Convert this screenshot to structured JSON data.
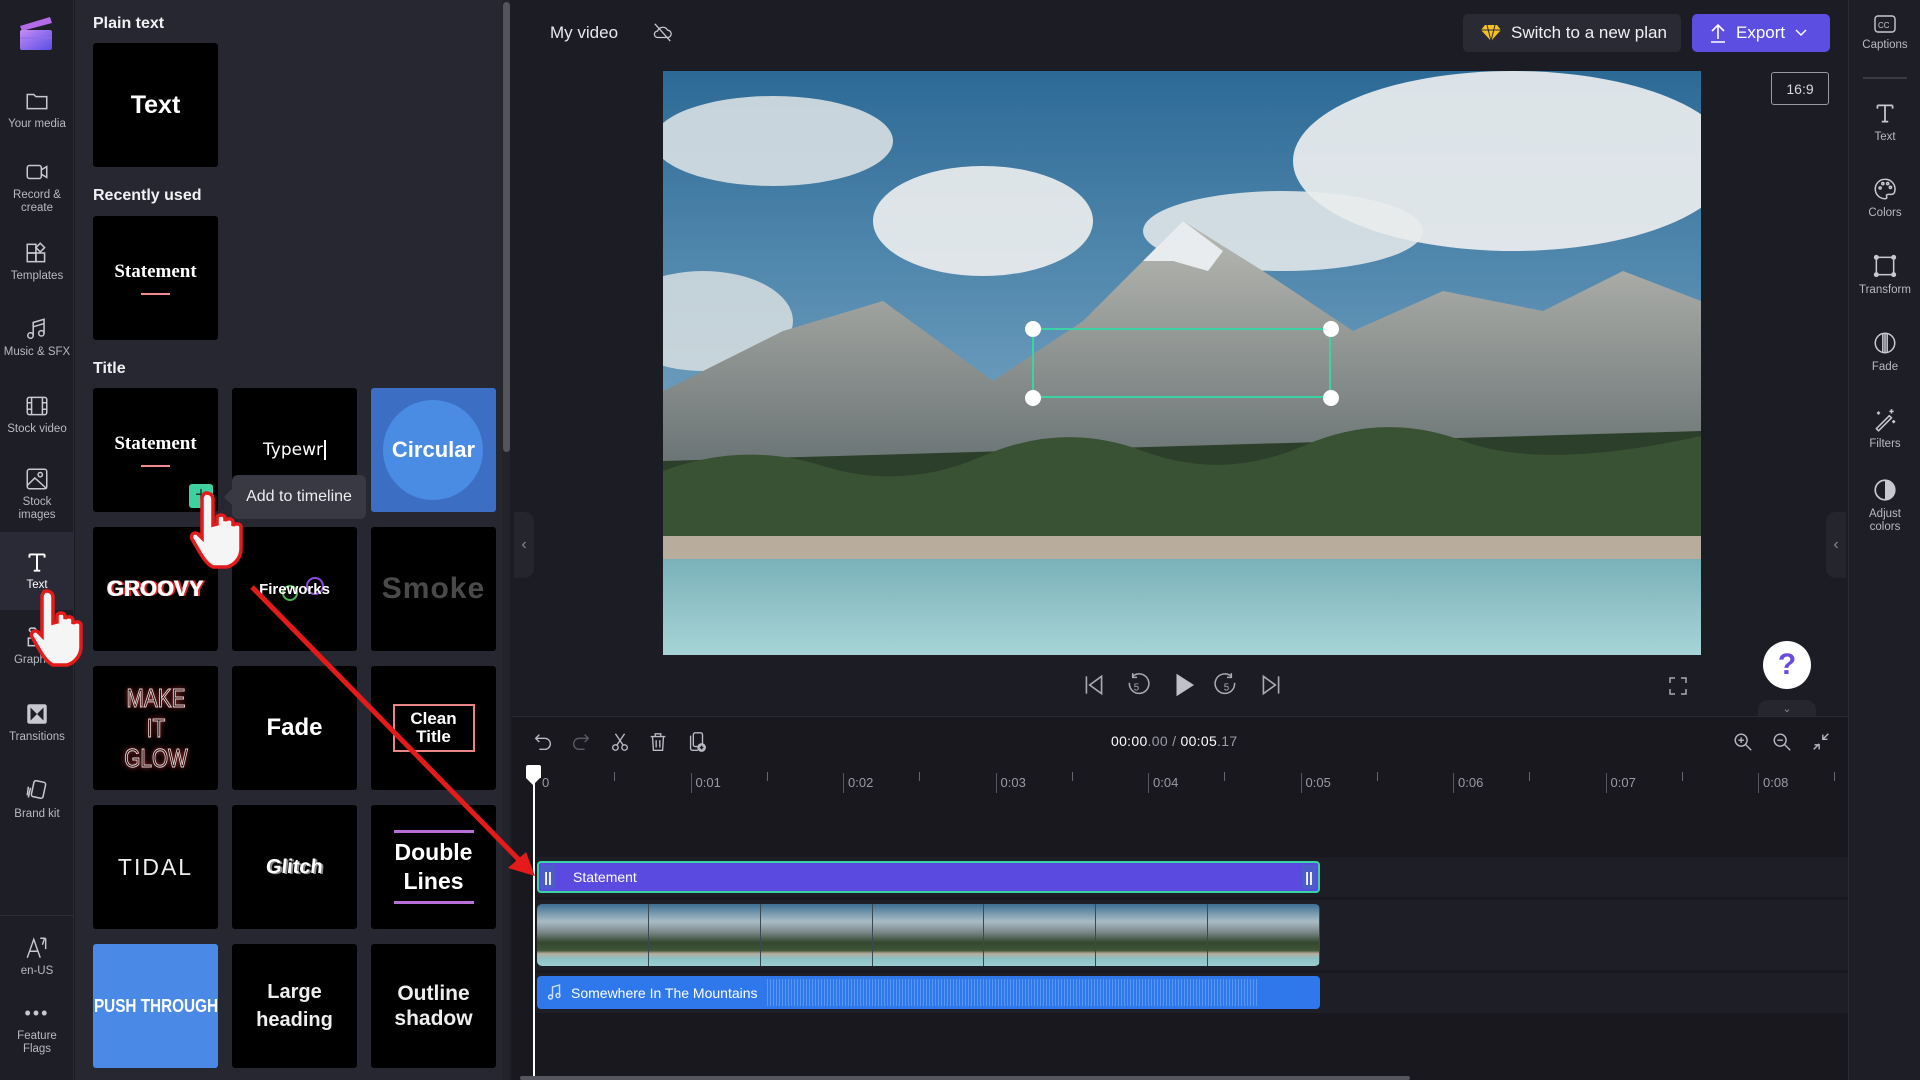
{
  "app": {
    "colors": {
      "accent": "#5b4ee0",
      "selection": "#3bd3a5",
      "text_clip": "#5b4adf",
      "audio_clip": "#2f78ec"
    }
  },
  "left_nav": {
    "items": [
      {
        "label": "Your media",
        "icon": "folder-icon"
      },
      {
        "label": "Record & create",
        "icon": "camera-icon"
      },
      {
        "label": "Templates",
        "icon": "templates-icon"
      },
      {
        "label": "Music & SFX",
        "icon": "music-icon"
      },
      {
        "label": "Stock video",
        "icon": "film-icon"
      },
      {
        "label": "Stock images",
        "icon": "image-icon"
      },
      {
        "label": "Text",
        "icon": "text-icon",
        "active": true
      },
      {
        "label": "Graphics",
        "icon": "graphics-icon"
      },
      {
        "label": "Transitions",
        "icon": "transitions-icon"
      },
      {
        "label": "Brand kit",
        "icon": "brand-kit-icon"
      }
    ],
    "bottom": [
      {
        "label": "en-US",
        "icon": "language-icon"
      },
      {
        "label": "Feature Flags",
        "icon": "more-icon"
      }
    ]
  },
  "text_panel": {
    "sections": {
      "plain_text": "Plain text",
      "recently_used": "Recently used",
      "title": "Title"
    },
    "plain_text_tiles": [
      "Text"
    ],
    "recent_tiles": [
      "Statement"
    ],
    "title_tiles": [
      "Statement",
      "Typewr",
      "Circular",
      "GROOVY",
      "Fireworks",
      "Smoke",
      "MAKE IT GLOW",
      "Fade",
      "Clean Title",
      "TIDAL",
      "Glitch",
      "Double Lines",
      "PUSH THROUGH",
      "Large heading",
      "Outline shadow"
    ],
    "tooltip": "Add to timeline",
    "add_button": "+"
  },
  "header": {
    "project_title": "My video",
    "plan_button": "Switch to a new plan",
    "export_button": "Export"
  },
  "preview": {
    "aspect_ratio": "16:9",
    "help": "?"
  },
  "right_nav": {
    "items": [
      {
        "label": "Captions",
        "icon": "captions-icon"
      },
      {
        "label": "Text",
        "icon": "text-icon"
      },
      {
        "label": "Colors",
        "icon": "palette-icon"
      },
      {
        "label": "Transform",
        "icon": "transform-icon"
      },
      {
        "label": "Fade",
        "icon": "fade-icon"
      },
      {
        "label": "Filters",
        "icon": "filters-icon"
      },
      {
        "label": "Adjust colors",
        "icon": "adjust-colors-icon"
      }
    ]
  },
  "timeline": {
    "current_time_main": "00:00",
    "current_time_frac": ".00",
    "separator": " / ",
    "total_time_main": "00:05",
    "total_time_frac": ".17",
    "ruler": [
      "0",
      "0:01",
      "0:02",
      "0:03",
      "0:04",
      "0:05",
      "0:06",
      "0:07",
      "0:08"
    ],
    "text_clip": "Statement",
    "audio_clip": "Somewhere In The Mountains"
  }
}
